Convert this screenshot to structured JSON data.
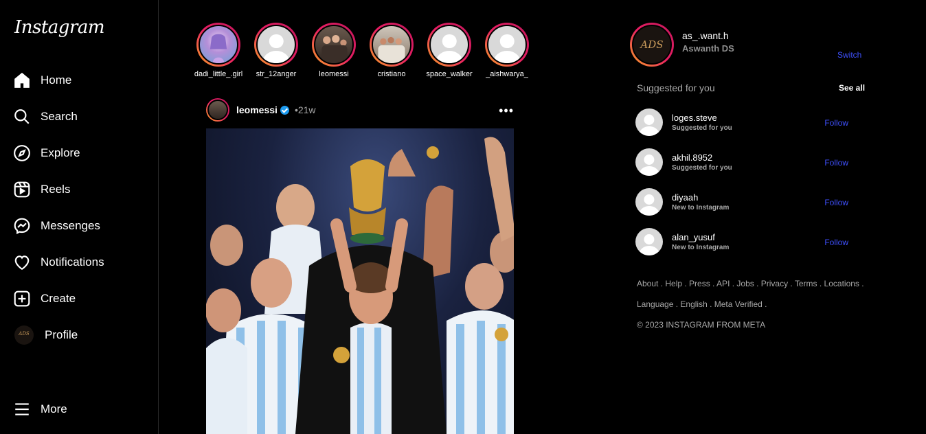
{
  "brand": {
    "logo": "Instagram"
  },
  "nav": {
    "home": "Home",
    "search": "Search",
    "explore": "Explore",
    "reels": "Reels",
    "messenges": "Messenges",
    "notifications": "Notifications",
    "create": "Create",
    "profile": "Profile",
    "more": "More"
  },
  "stories": [
    {
      "name": "dadi_little_.girl"
    },
    {
      "name": "str_12anger"
    },
    {
      "name": "leomessi"
    },
    {
      "name": "cristiano"
    },
    {
      "name": "space_walker"
    },
    {
      "name": "_aishwarya_"
    }
  ],
  "post": {
    "user": "leomessi",
    "time": "•21w",
    "menu": "•••"
  },
  "me": {
    "username": "as_.want.h",
    "fullname": "Aswanth DS",
    "switch": "Switch",
    "avatar_text": "ADS"
  },
  "suggestions": {
    "title": "Suggested for you",
    "see_all": "See all",
    "follow_label": "Follow",
    "items": [
      {
        "user": "loges.steve",
        "sub": "Suggested for you"
      },
      {
        "user": "akhil.8952",
        "sub": "Suggested for you"
      },
      {
        "user": "diyaah",
        "sub": "New to Instagram"
      },
      {
        "user": "alan_yusuf",
        "sub": "New to Instagram"
      }
    ]
  },
  "footer": {
    "line1": "About . Help . Press . API . Jobs . Privacy . Terms . Locations .",
    "line2": "Language . English . Meta Verified .",
    "copyright": "© 2023 INSTAGRAM FROM META"
  },
  "colors": {
    "accent": "#3f51ff",
    "verified": "#1d9bf0",
    "ring_start": "#f9a825",
    "ring_end": "#c2185b"
  }
}
